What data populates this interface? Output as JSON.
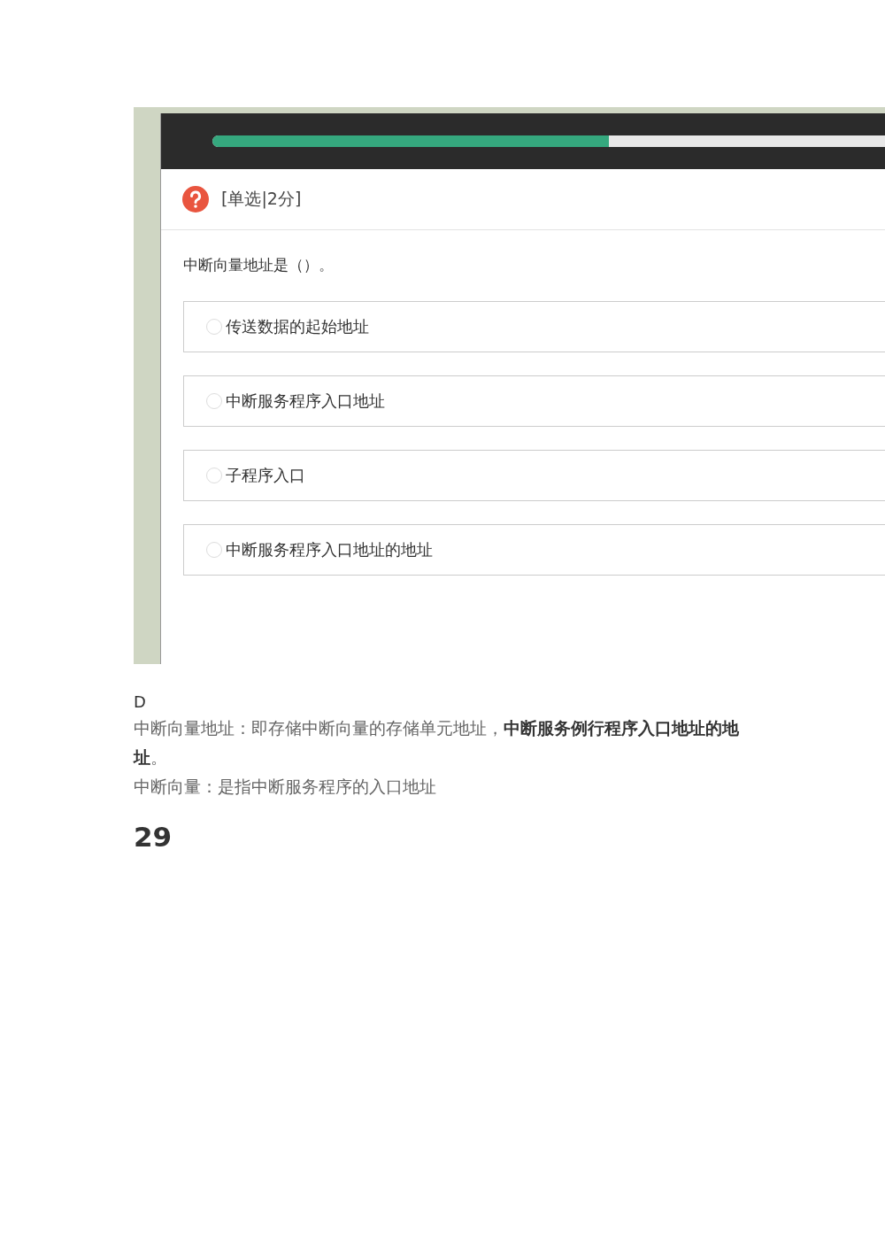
{
  "quiz": {
    "progress": {
      "level": 0.59
    },
    "question_type": "[单选|2分]",
    "question": "中断向量地址是（）。",
    "options": [
      {
        "text": "传送数据的起始地址",
        "selected": false
      },
      {
        "text": "中断服务程序入口地址",
        "selected": false
      },
      {
        "text": "子程序入口",
        "selected": false
      },
      {
        "text": "中断服务程序入口地址的地址",
        "selected": false
      }
    ]
  },
  "answer": "D",
  "explanation": [
    "中断向量地址：即存储中断向量的存储单元地址，**中断服务例行程序入口地址的地址**。",
    "中断向量：是指中断服务程序的入口地址"
  ],
  "next_number": "29"
}
